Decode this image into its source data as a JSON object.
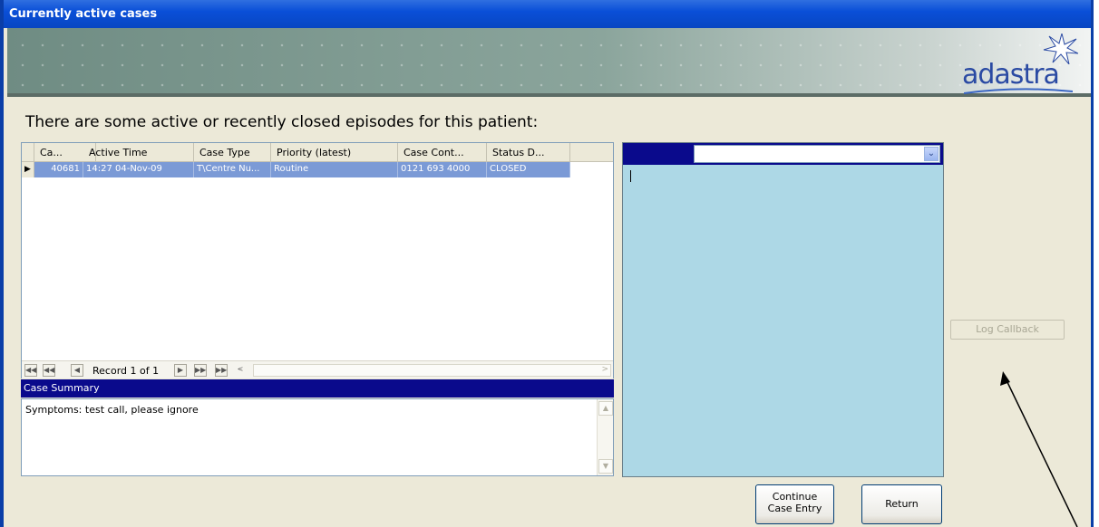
{
  "window": {
    "title": "Currently active cases"
  },
  "banner": {
    "logo_text": "adastra"
  },
  "heading": "There are some active or recently closed episodes for this patient:",
  "grid": {
    "columns": [
      "Ca...",
      "Active Time",
      "Case Type",
      "Priority (latest)",
      "Case Cont...",
      "Status D..."
    ],
    "rows": [
      [
        "40681",
        "14:27  04-Nov-09",
        "T\\Centre Nu...",
        "Routine",
        "0121 693 4000",
        "CLOSED"
      ]
    ],
    "record_label": "Record 1 of 1"
  },
  "summary": {
    "label": "Case Summary",
    "text": "Symptoms: test call, please ignore"
  },
  "notes": {
    "selected": ""
  },
  "buttons": {
    "log_callback": "Log Callback",
    "continue_line1": "Continue",
    "continue_line2": "Case Entry",
    "return": "Return"
  },
  "colors": {
    "title_bar": "#0a4fd8",
    "selection": "#7b9ad6",
    "dark_band": "#0a0a8c",
    "notes_bg": "#add8e6"
  }
}
